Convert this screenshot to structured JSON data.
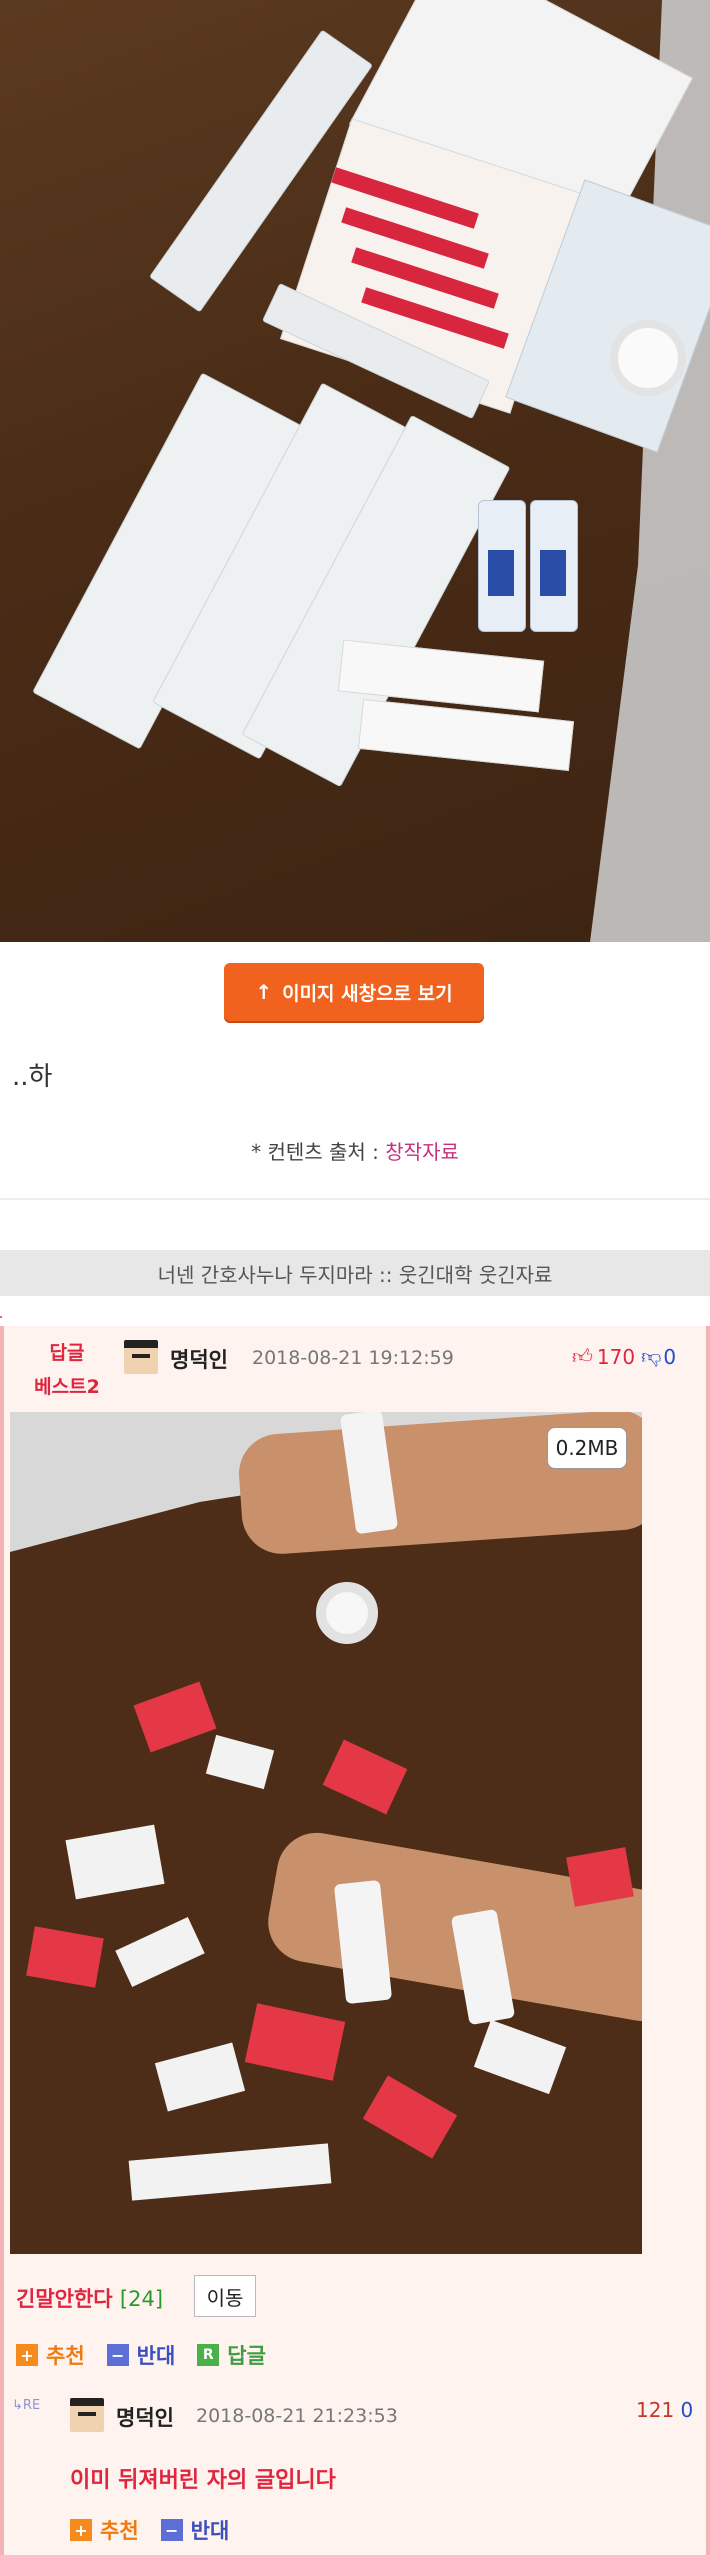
{
  "open_image_button": {
    "label": "이미지 새창으로 보기",
    "arrow": "↑"
  },
  "post": {
    "caption": "..하"
  },
  "source": {
    "label": "* 컨텐츠 출처 :",
    "link": "창작자료"
  },
  "related_title": "너넨 간호사누나 두지마라 :: 웃긴대학 웃긴자료",
  "best_reply": {
    "badge_line1": "답글",
    "badge_line2": "베스트2",
    "nickname": "명덕인",
    "datetime": "2018-08-21 19:12:59",
    "upvotes": "170",
    "downvotes": "0",
    "image_size": "0.2MB",
    "long_text": "긴말안한다",
    "long_count": "[24]",
    "move_label": "이동",
    "actions": {
      "recommend": "추천",
      "oppose": "반대",
      "reply": "답글"
    }
  },
  "nested_reply": {
    "re_label": "RE",
    "nickname": "명덕인",
    "datetime": "2018-08-21 21:23:53",
    "upvotes": "121",
    "downvotes": "0",
    "text": "이미 뒤져버린 자의 글입니다",
    "actions": {
      "recommend": "추천",
      "oppose": "반대"
    }
  },
  "colors": {
    "accent_orange": "#f0621e",
    "best_red": "#e0253f",
    "link_pink": "#c5307f",
    "panel_bg": "#fef3ee"
  }
}
